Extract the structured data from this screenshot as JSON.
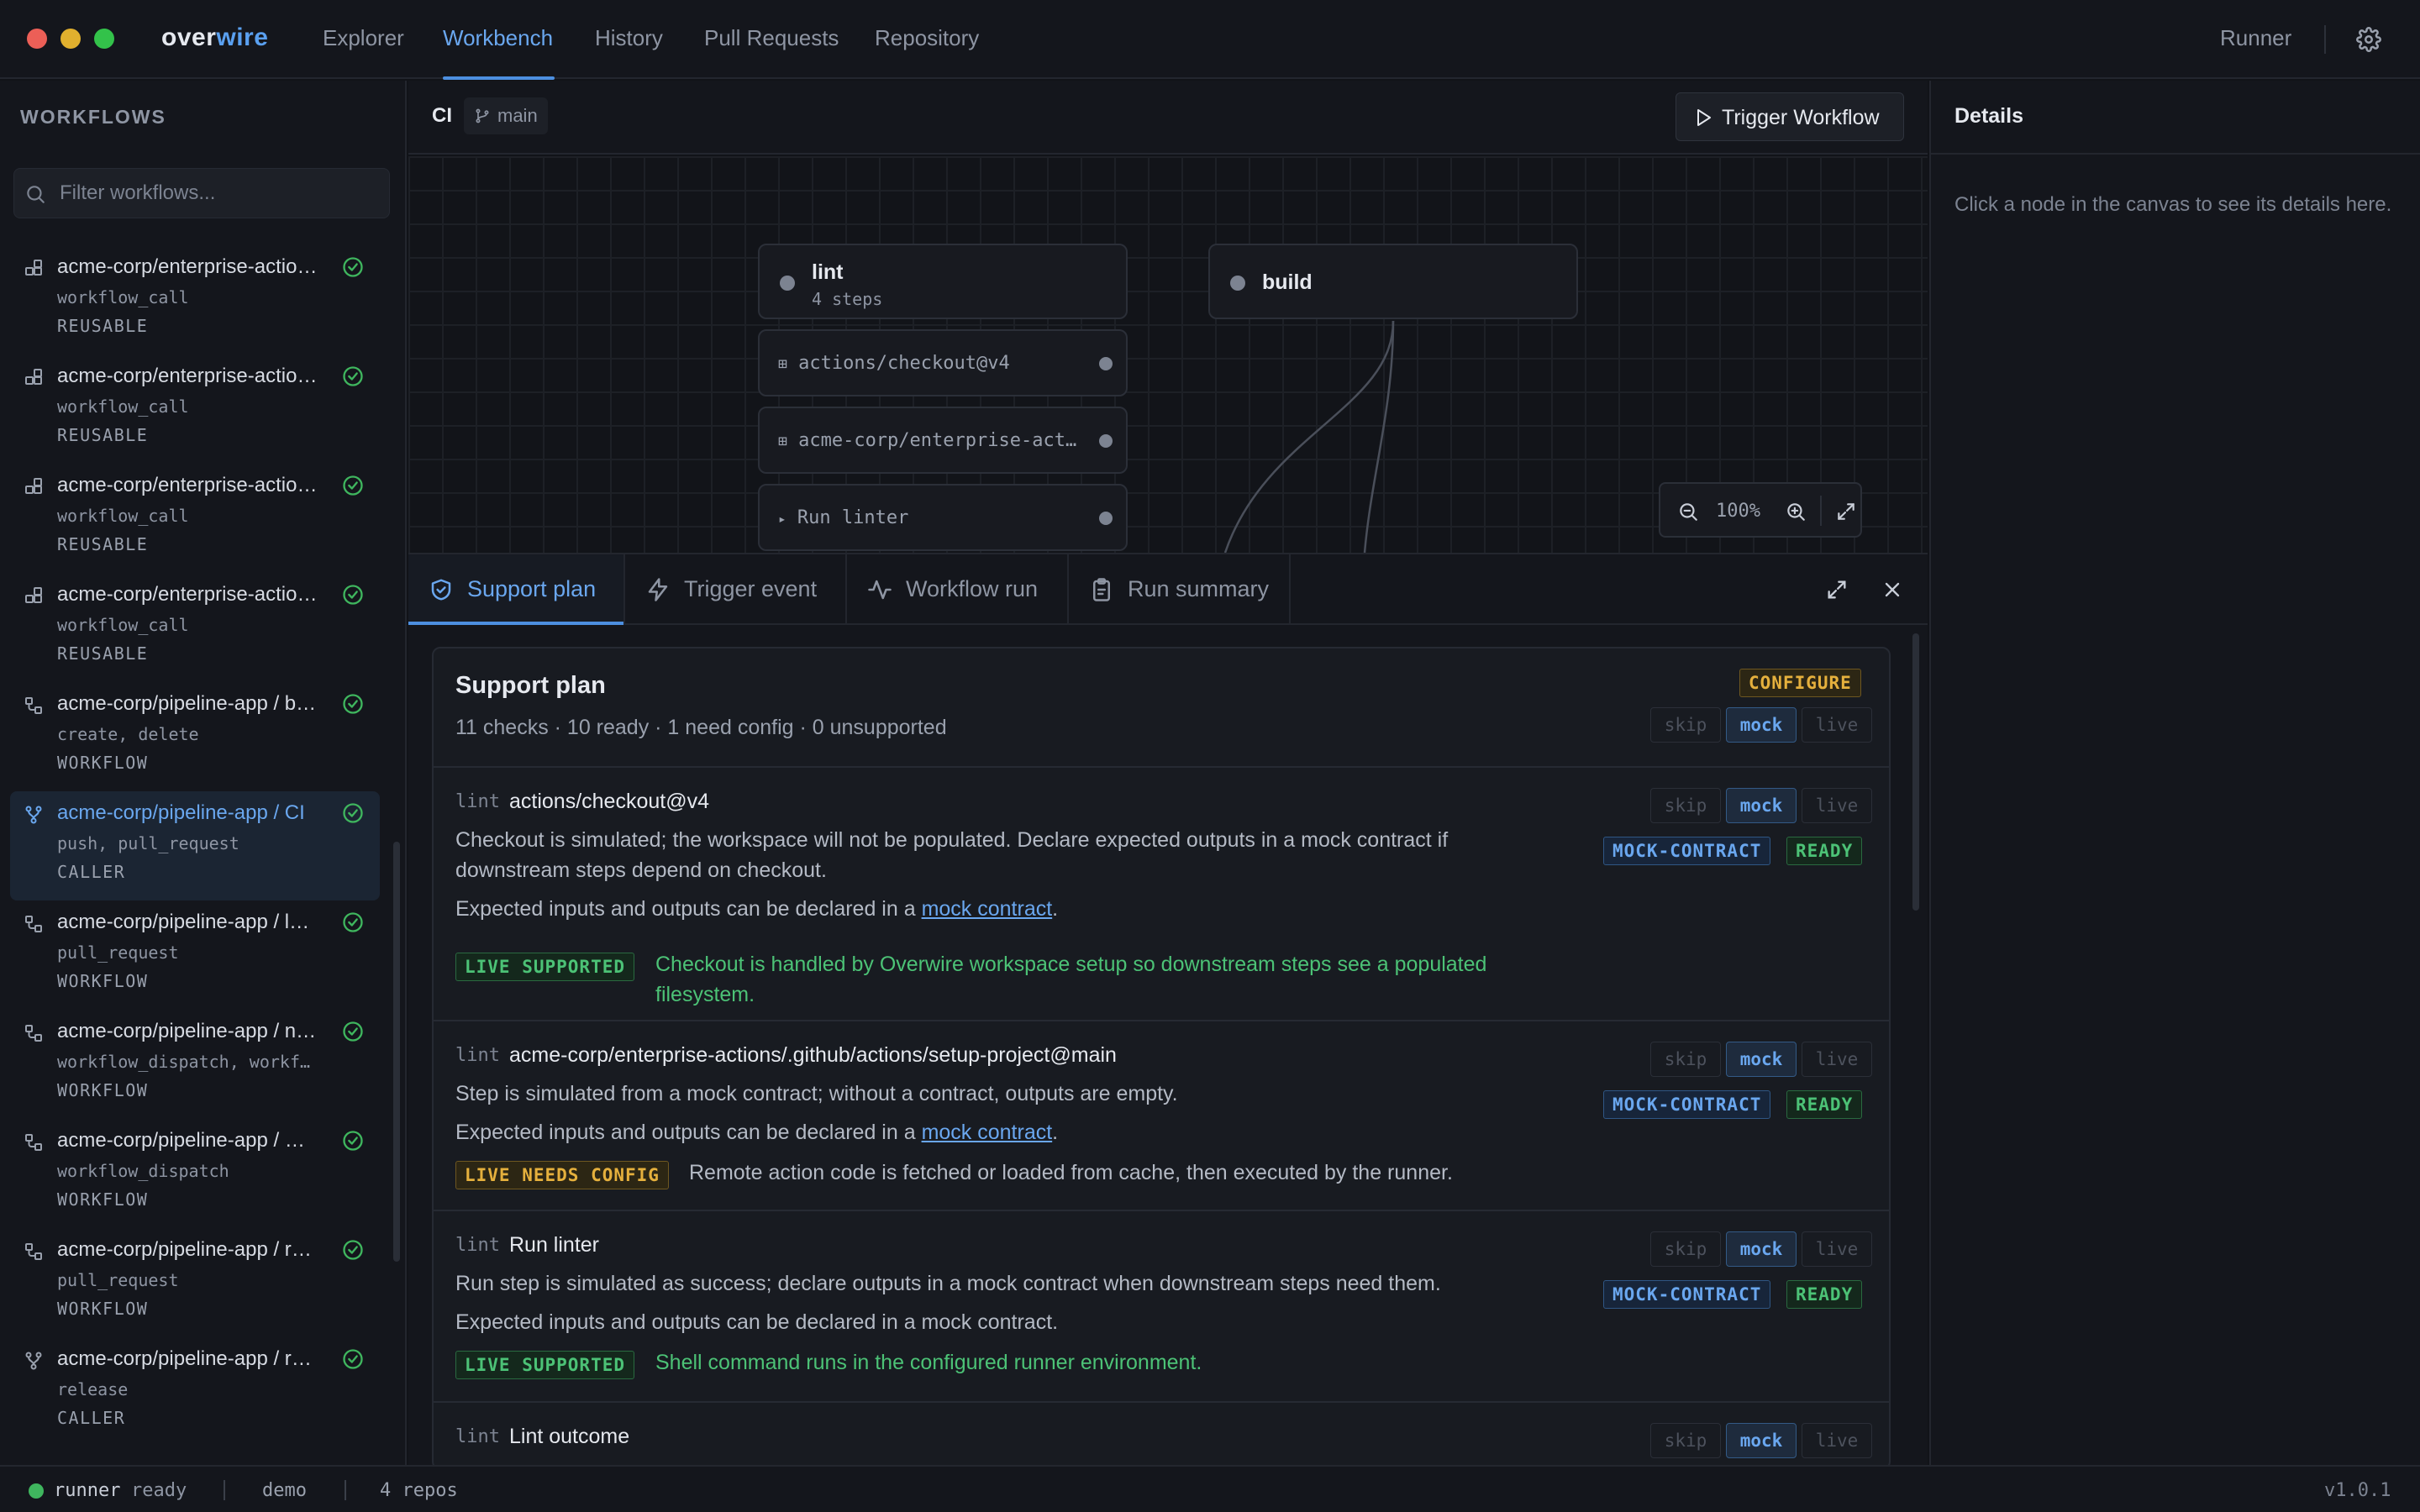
{
  "window": {
    "traffic_lights": [
      "#ec5f57",
      "#e1b02e",
      "#33c24a"
    ]
  },
  "brand": {
    "part1": "over",
    "part2": "wire"
  },
  "nav": {
    "tabs": [
      "Explorer",
      "Workbench",
      "History",
      "Pull Requests",
      "Repository"
    ],
    "active": "Workbench",
    "runner": "Runner"
  },
  "sidebar": {
    "title": "WORKFLOWS",
    "filter_placeholder": "Filter workflows...",
    "items": [
      {
        "name": "acme-corp/enterprise-actions/.github/workflows/reusable-build.yml",
        "trigger": "workflow_call",
        "kind": "REUSABLE",
        "icon": "reusable-icon"
      },
      {
        "name": "acme-corp/enterprise-actions/.github/workflows/reusable-test.yml",
        "trigger": "workflow_call",
        "kind": "REUSABLE",
        "icon": "reusable-icon"
      },
      {
        "name": "acme-corp/enterprise-actions/.github/workflows/reusable-deploy.yml",
        "trigger": "workflow_call",
        "kind": "REUSABLE",
        "icon": "reusable-icon"
      },
      {
        "name": "acme-corp/enterprise-actions/.github/workflows/reusable-lint.yml",
        "trigger": "workflow_call",
        "kind": "REUSABLE",
        "icon": "reusable-icon"
      },
      {
        "name": "acme-corp/pipeline-app / branches",
        "trigger": "create, delete",
        "kind": "WORKFLOW",
        "icon": "workflow-icon"
      },
      {
        "name": "acme-corp/pipeline-app / CI",
        "trigger": "push, pull_request",
        "kind": "CALLER",
        "icon": "caller-icon",
        "selected": true
      },
      {
        "name": "acme-corp/pipeline-app / labeler",
        "trigger": "pull_request",
        "kind": "WORKFLOW",
        "icon": "workflow-icon"
      },
      {
        "name": "acme-corp/pipeline-app / nightly",
        "trigger": "workflow_dispatch, workflow_run",
        "kind": "WORKFLOW",
        "icon": "workflow-icon"
      },
      {
        "name": "acme-corp/pipeline-app / manual",
        "trigger": "workflow_dispatch",
        "kind": "WORKFLOW",
        "icon": "workflow-icon"
      },
      {
        "name": "acme-corp/pipeline-app / review",
        "trigger": "pull_request",
        "kind": "WORKFLOW",
        "icon": "workflow-icon"
      },
      {
        "name": "acme-corp/pipeline-app / release",
        "trigger": "release",
        "kind": "CALLER",
        "icon": "caller-icon"
      }
    ]
  },
  "toolbar": {
    "workflow": "CI",
    "branch": "main",
    "trigger_label": "Trigger Workflow"
  },
  "canvas": {
    "jobs": [
      {
        "title": "lint",
        "subtitle": "4 steps"
      },
      {
        "title": "build"
      }
    ],
    "steps": [
      {
        "label": "actions/checkout@v4",
        "glyph": "⊞"
      },
      {
        "label": "acme-corp/enterprise-actions/.github/actions/setup-project@main",
        "glyph": "⊞"
      },
      {
        "label": "Run linter",
        "glyph": "▸"
      }
    ],
    "zoom": "100%"
  },
  "panel": {
    "tabs": [
      "Support plan",
      "Trigger event",
      "Workflow run",
      "Run summary"
    ],
    "active": "Support plan"
  },
  "plan": {
    "title": "Support plan",
    "summary": "11 checks · 10 ready · 1 need config · 0 unsupported",
    "badge": "CONFIGURE",
    "modes": [
      "skip",
      "mock",
      "live"
    ],
    "mode_selected": "mock",
    "checks": [
      {
        "job": "lint",
        "action": "actions/checkout@v4",
        "desc": "Checkout is simulated; the workspace will not be populated. Declare expected outputs in a mock contract if downstream steps depend on checkout.",
        "hint_pre": "Expected inputs and outputs can be declared in a",
        "hint_link": "mock contract",
        "hint_post": ".",
        "tags": [
          "MOCK-CONTRACT",
          "READY"
        ],
        "live_badge": "LIVE SUPPORTED",
        "live_note": "Checkout is handled by Overwire workspace setup so downstream steps see a populated filesystem."
      },
      {
        "job": "lint",
        "action": "acme-corp/enterprise-actions/.github/actions/setup-project@main",
        "desc": "Step is simulated from a mock contract; without a contract, outputs are empty.",
        "hint_pre": "Expected inputs and outputs can be declared in a",
        "hint_link": "mock contract",
        "hint_post": ".",
        "tags": [
          "MOCK-CONTRACT",
          "READY"
        ],
        "live_badge": "LIVE NEEDS CONFIG",
        "live_note": "Remote action code is fetched or loaded from cache, then executed by the runner."
      },
      {
        "job": "lint",
        "action": "Run linter",
        "desc": "Run step is simulated as success; declare outputs in a mock contract when downstream steps need them.",
        "hint_pre": "Expected inputs and outputs can be declared in a mock contract.",
        "tags": [
          "MOCK-CONTRACT",
          "READY"
        ],
        "live_badge": "LIVE SUPPORTED",
        "live_note": "Shell command runs in the configured runner environment."
      },
      {
        "job": "lint",
        "action": "Lint outcome"
      }
    ]
  },
  "details": {
    "title": "Details",
    "hint": "Click a node in the canvas to see its details here."
  },
  "status": {
    "runner": "runner",
    "state": "ready",
    "env": "demo",
    "repos": "4 repos",
    "version": "v1.0.1"
  }
}
